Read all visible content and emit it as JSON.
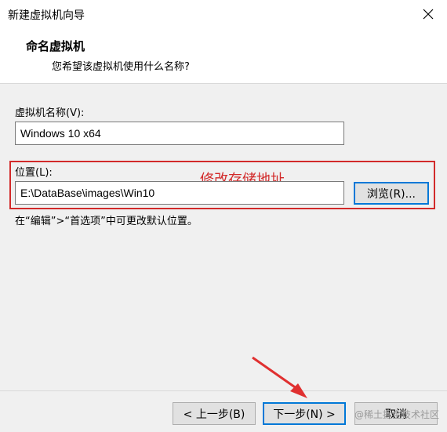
{
  "window": {
    "title": "新建虚拟机向导"
  },
  "header": {
    "title": "命名虚拟机",
    "subtitle": "您希望该虚拟机使用什么名称?"
  },
  "form": {
    "name_label": "虚拟机名称(V):",
    "name_value": "Windows 10 x64",
    "location_label": "位置(L):",
    "location_value": "E:\\DataBase\\images\\Win10",
    "browse_label": "浏览(R)...",
    "hint": "在“编辑”>“首选项”中可更改默认位置。"
  },
  "annotation": {
    "text": "修改存储地址",
    "color": "#d22a2a"
  },
  "footer": {
    "back_label": "< 上一步(B)",
    "next_label": "下一步(N) >",
    "cancel_label": "取消"
  },
  "watermark": "@稀土掘金技术社区",
  "colors": {
    "focus": "#0078d7",
    "annotation": "#d22a2a"
  }
}
